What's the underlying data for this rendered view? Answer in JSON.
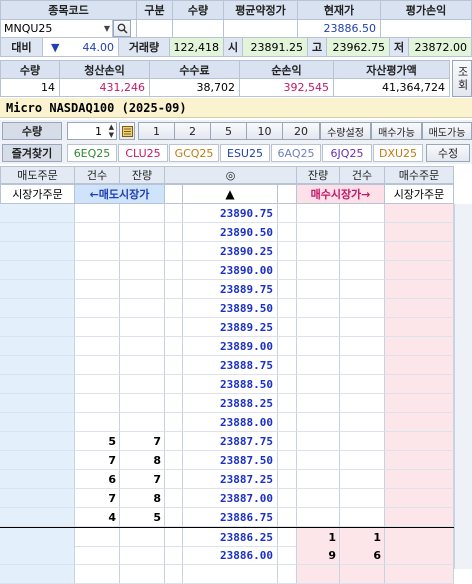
{
  "top_headers": [
    "종목코드",
    "구분",
    "수량",
    "평균약정가",
    "현재가",
    "평가손익"
  ],
  "symbol": {
    "code": "MNQU25",
    "search_icon": "search-icon",
    "current_price": "23886.50"
  },
  "row2": {
    "label_diff": "대비",
    "diff_arrow": "▼",
    "diff_value": "44.00",
    "label_volume": "거래량",
    "volume": "122,418",
    "label_open": "시",
    "open": "23891.25",
    "label_high": "고",
    "high": "23962.75",
    "label_low": "저",
    "low": "23872.00"
  },
  "summary": {
    "headers": [
      "수량",
      "청산손익",
      "수수료",
      "순손익",
      "자산평가액"
    ],
    "values": [
      "14",
      "431,246",
      "38,702",
      "392,545",
      "41,364,724"
    ],
    "query_button": "조회"
  },
  "instrument_title": "Micro NASDAQ100 (2025-09)",
  "qty_bar": {
    "label": "수량",
    "qty_value": "1",
    "presets": [
      "1",
      "2",
      "5",
      "10",
      "20"
    ],
    "qty_setting": "수량설정",
    "buy_avail": "매수가능",
    "sell_avail": "매도가능"
  },
  "favorites": {
    "label": "즐겨찾기",
    "items": [
      {
        "text": "6EQ25",
        "color": "#2f8a2f"
      },
      {
        "text": "CLU25",
        "color": "#c0186a"
      },
      {
        "text": "GCQ25",
        "color": "#c07a10"
      },
      {
        "text": "ESU25",
        "color": "#1f3fb5"
      },
      {
        "text": "6AQ25",
        "color": "#6f7fc0"
      },
      {
        "text": "6JQ25",
        "color": "#6a2fb0"
      },
      {
        "text": "DXU25",
        "color": "#c07a10"
      }
    ],
    "edit": "수정"
  },
  "order_headers": {
    "sell_order": "매도주문",
    "count_l": "건수",
    "remain_l": "잔량",
    "center_icon": "◎",
    "remain_r": "잔량",
    "count_r": "건수",
    "buy_order": "매수주문"
  },
  "order_actions": {
    "sell_market_order": "시장가주문",
    "sell_market": "←매도시장가",
    "up_arrow": "▲",
    "buy_market": "매수시장가→",
    "buy_market_order": "시장가주문"
  },
  "ladder": [
    {
      "price": "23890.75",
      "ask_count": "",
      "ask_qty": "",
      "bid_qty": "",
      "bid_count": ""
    },
    {
      "price": "23890.50",
      "ask_count": "",
      "ask_qty": "",
      "bid_qty": "",
      "bid_count": ""
    },
    {
      "price": "23890.25",
      "ask_count": "",
      "ask_qty": "",
      "bid_qty": "",
      "bid_count": ""
    },
    {
      "price": "23890.00",
      "ask_count": "",
      "ask_qty": "",
      "bid_qty": "",
      "bid_count": ""
    },
    {
      "price": "23889.75",
      "ask_count": "",
      "ask_qty": "",
      "bid_qty": "",
      "bid_count": ""
    },
    {
      "price": "23889.50",
      "ask_count": "",
      "ask_qty": "",
      "bid_qty": "",
      "bid_count": ""
    },
    {
      "price": "23889.25",
      "ask_count": "",
      "ask_qty": "",
      "bid_qty": "",
      "bid_count": ""
    },
    {
      "price": "23889.00",
      "ask_count": "",
      "ask_qty": "",
      "bid_qty": "",
      "bid_count": ""
    },
    {
      "price": "23888.75",
      "ask_count": "",
      "ask_qty": "",
      "bid_qty": "",
      "bid_count": ""
    },
    {
      "price": "23888.50",
      "ask_count": "",
      "ask_qty": "",
      "bid_qty": "",
      "bid_count": ""
    },
    {
      "price": "23888.25",
      "ask_count": "",
      "ask_qty": "",
      "bid_qty": "",
      "bid_count": ""
    },
    {
      "price": "23888.00",
      "ask_count": "",
      "ask_qty": "",
      "bid_qty": "",
      "bid_count": ""
    },
    {
      "price": "23887.75",
      "ask_count": "5",
      "ask_qty": "7",
      "bid_qty": "",
      "bid_count": ""
    },
    {
      "price": "23887.50",
      "ask_count": "7",
      "ask_qty": "8",
      "bid_qty": "",
      "bid_count": ""
    },
    {
      "price": "23887.25",
      "ask_count": "6",
      "ask_qty": "7",
      "bid_qty": "",
      "bid_count": ""
    },
    {
      "price": "23887.00",
      "ask_count": "7",
      "ask_qty": "8",
      "bid_qty": "",
      "bid_count": ""
    },
    {
      "price": "23886.75",
      "ask_count": "4",
      "ask_qty": "5",
      "bid_qty": "",
      "bid_count": ""
    },
    {
      "price": "23886.25",
      "ask_count": "",
      "ask_qty": "",
      "bid_qty": "1",
      "bid_count": "1"
    },
    {
      "price": "23886.00",
      "ask_count": "",
      "ask_qty": "",
      "bid_qty": "9",
      "bid_count": "6"
    },
    {
      "price": "",
      "ask_count": "",
      "ask_qty": "",
      "bid_qty": "",
      "bid_count": ""
    }
  ]
}
